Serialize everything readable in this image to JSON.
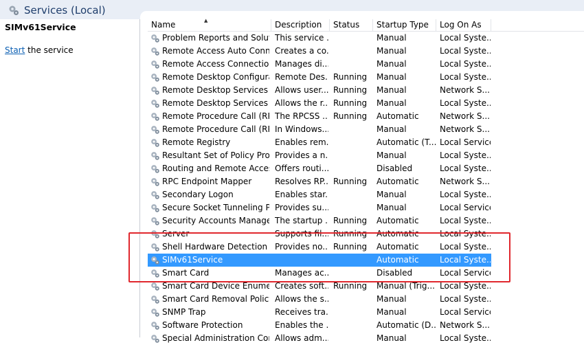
{
  "window": {
    "title": "Services (Local)"
  },
  "left_pane": {
    "service_name": "SIMv61Service",
    "action_link": "Start",
    "action_rest": " the service"
  },
  "columns": [
    "Name",
    "Description",
    "Status",
    "Startup Type",
    "Log On As"
  ],
  "rows": [
    {
      "name": "Problem Reports and Soluti...",
      "description": "This service ...",
      "status": "",
      "startup": "Manual",
      "logon": "Local Syste..."
    },
    {
      "name": "Remote Access Auto Conne...",
      "description": "Creates a co...",
      "status": "",
      "startup": "Manual",
      "logon": "Local Syste..."
    },
    {
      "name": "Remote Access Connection...",
      "description": "Manages di...",
      "status": "",
      "startup": "Manual",
      "logon": "Local Syste..."
    },
    {
      "name": "Remote Desktop Configurat...",
      "description": "Remote Des...",
      "status": "Running",
      "startup": "Manual",
      "logon": "Local Syste..."
    },
    {
      "name": "Remote Desktop Services",
      "description": "Allows user...",
      "status": "Running",
      "startup": "Manual",
      "logon": "Network S..."
    },
    {
      "name": "Remote Desktop Services U...",
      "description": "Allows the r...",
      "status": "Running",
      "startup": "Manual",
      "logon": "Local Syste..."
    },
    {
      "name": "Remote Procedure Call (RPC)",
      "description": "The RPCSS ...",
      "status": "Running",
      "startup": "Automatic",
      "logon": "Network S..."
    },
    {
      "name": "Remote Procedure Call (RP...",
      "description": "In Windows...",
      "status": "",
      "startup": "Manual",
      "logon": "Network S..."
    },
    {
      "name": "Remote Registry",
      "description": "Enables rem...",
      "status": "",
      "startup": "Automatic (T...",
      "logon": "Local Service"
    },
    {
      "name": "Resultant Set of Policy Provi...",
      "description": "Provides a n...",
      "status": "",
      "startup": "Manual",
      "logon": "Local Syste..."
    },
    {
      "name": "Routing and Remote Access",
      "description": "Offers routi...",
      "status": "",
      "startup": "Disabled",
      "logon": "Local Syste..."
    },
    {
      "name": "RPC Endpoint Mapper",
      "description": "Resolves RP...",
      "status": "Running",
      "startup": "Automatic",
      "logon": "Network S..."
    },
    {
      "name": "Secondary Logon",
      "description": "Enables star...",
      "status": "",
      "startup": "Manual",
      "logon": "Local Syste..."
    },
    {
      "name": "Secure Socket Tunneling Pr...",
      "description": "Provides su...",
      "status": "",
      "startup": "Manual",
      "logon": "Local Service"
    },
    {
      "name": "Security Accounts Manager",
      "description": "The startup ...",
      "status": "Running",
      "startup": "Automatic",
      "logon": "Local Syste..."
    },
    {
      "name": "Server",
      "description": "Supports fil...",
      "status": "Running",
      "startup": "Automatic",
      "logon": "Local Syste..."
    },
    {
      "name": "Shell Hardware Detection",
      "description": "Provides no...",
      "status": "Running",
      "startup": "Automatic",
      "logon": "Local Syste..."
    },
    {
      "name": "SIMv61Service",
      "description": "",
      "status": "",
      "startup": "Automatic",
      "logon": "Local Syste...",
      "selected": true
    },
    {
      "name": "Smart Card",
      "description": "Manages ac...",
      "status": "",
      "startup": "Disabled",
      "logon": "Local Service"
    },
    {
      "name": "Smart Card Device Enumera...",
      "description": "Creates soft...",
      "status": "Running",
      "startup": "Manual (Trig...",
      "logon": "Local Syste..."
    },
    {
      "name": "Smart Card Removal Policy",
      "description": "Allows the s...",
      "status": "",
      "startup": "Manual",
      "logon": "Local Syste..."
    },
    {
      "name": "SNMP Trap",
      "description": "Receives tra...",
      "status": "",
      "startup": "Manual",
      "logon": "Local Service"
    },
    {
      "name": "Software Protection",
      "description": "Enables the ...",
      "status": "",
      "startup": "Automatic (D...",
      "logon": "Network S..."
    },
    {
      "name": "Special Administration Con...",
      "description": "Allows adm...",
      "status": "",
      "startup": "Manual",
      "logon": "Local Syste..."
    }
  ],
  "colors": {
    "selection": "#3399ff",
    "highlight": "#e0272d",
    "link": "#0b5fb3",
    "title": "#1e3d6b"
  },
  "icons": {
    "title": "services-gear-icon",
    "row": "service-gear-icon"
  }
}
